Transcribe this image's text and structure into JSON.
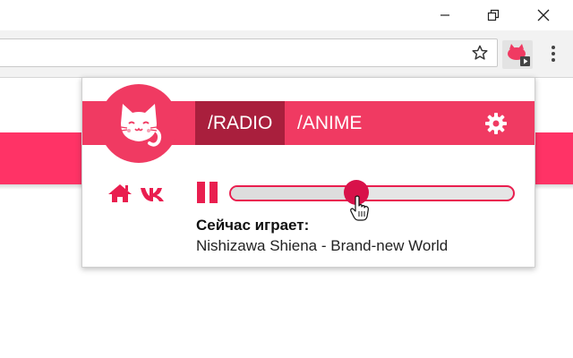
{
  "window": {
    "controls": [
      "minimize",
      "restore",
      "close"
    ]
  },
  "browser": {
    "address_value": "",
    "bookmark_icon": "star-icon",
    "extension_icon": "cat-radio-extension-icon",
    "menu_icon": "kebab-menu-icon"
  },
  "popup": {
    "tabs": [
      {
        "label": "/RADIO",
        "active": true
      },
      {
        "label": "/ANIME",
        "active": false
      }
    ],
    "settings_icon": "gear-icon",
    "player": {
      "state": "playing",
      "volume_fraction": 0.44,
      "now_playing_label": "Сейчас играет:",
      "track": "Nishizawa Shiena - Brand-new World"
    },
    "links": [
      "home-icon",
      "vk-icon"
    ]
  },
  "colors": {
    "accent": "#f03a62",
    "tab_active": "#a91f3d",
    "page_stripe": "#ff3366",
    "thumb": "#d8124a"
  }
}
